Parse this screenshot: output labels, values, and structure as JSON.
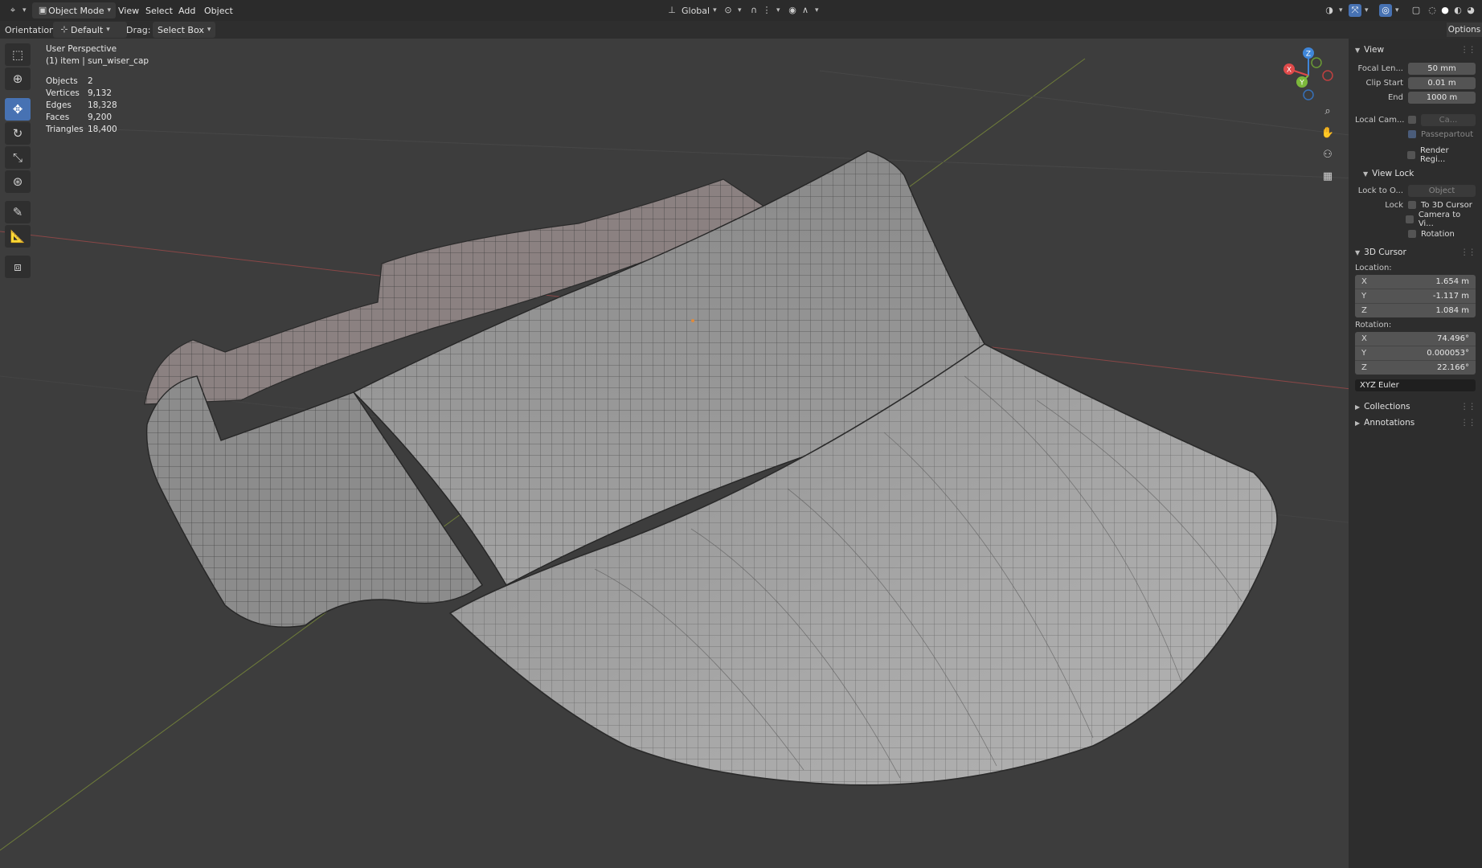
{
  "topbar": {
    "mode": "Object Mode",
    "menus": [
      "View",
      "Select",
      "Add",
      "Object"
    ],
    "transform_orientation": "Global"
  },
  "tool_header": {
    "orientation_label": "Orientation:",
    "orientation_value": "Default",
    "drag_label": "Drag:",
    "drag_value": "Select Box",
    "options_label": "Options"
  },
  "overlay": {
    "view_name": "User Perspective",
    "selection": "(1) item | sun_wiser_cap",
    "stats": [
      {
        "label": "Objects",
        "value": "2"
      },
      {
        "label": "Vertices",
        "value": "9,132"
      },
      {
        "label": "Edges",
        "value": "18,328"
      },
      {
        "label": "Faces",
        "value": "9,200"
      },
      {
        "label": "Triangles",
        "value": "18,400"
      }
    ]
  },
  "gizmo": {
    "x": "X",
    "y": "Y",
    "z": "Z",
    "colors": {
      "x": "#e04a4a",
      "y": "#7cb83b",
      "z": "#3f86d9"
    }
  },
  "npanel": {
    "view": {
      "title": "View",
      "focal_label": "Focal Len...",
      "focal_value": "50 mm",
      "clip_start_label": "Clip Start",
      "clip_start_value": "0.01 m",
      "end_label": "End",
      "end_value": "1000 m",
      "local_cam_label": "Local Cam...",
      "local_cam_value": "Ca...",
      "passepartout": "Passepartout",
      "render_region": "Render Regi..."
    },
    "view_lock": {
      "title": "View Lock",
      "lock_to_label": "Lock to O...",
      "lock_to_value": "Object",
      "lock_label": "Lock",
      "to_cursor": "To 3D Cursor",
      "camera_to_view": "Camera to Vi...",
      "rotation": "Rotation"
    },
    "cursor": {
      "title": "3D Cursor",
      "location_label": "Location:",
      "location": [
        {
          "axis": "X",
          "value": "1.654 m"
        },
        {
          "axis": "Y",
          "value": "-1.117 m"
        },
        {
          "axis": "Z",
          "value": "1.084 m"
        }
      ],
      "rotation_label": "Rotation:",
      "rotation": [
        {
          "axis": "X",
          "value": "74.496°"
        },
        {
          "axis": "Y",
          "value": "0.000053°"
        },
        {
          "axis": "Z",
          "value": "22.166°"
        }
      ],
      "rotation_mode": "XYZ Euler"
    },
    "collections": "Collections",
    "annotations": "Annotations"
  }
}
